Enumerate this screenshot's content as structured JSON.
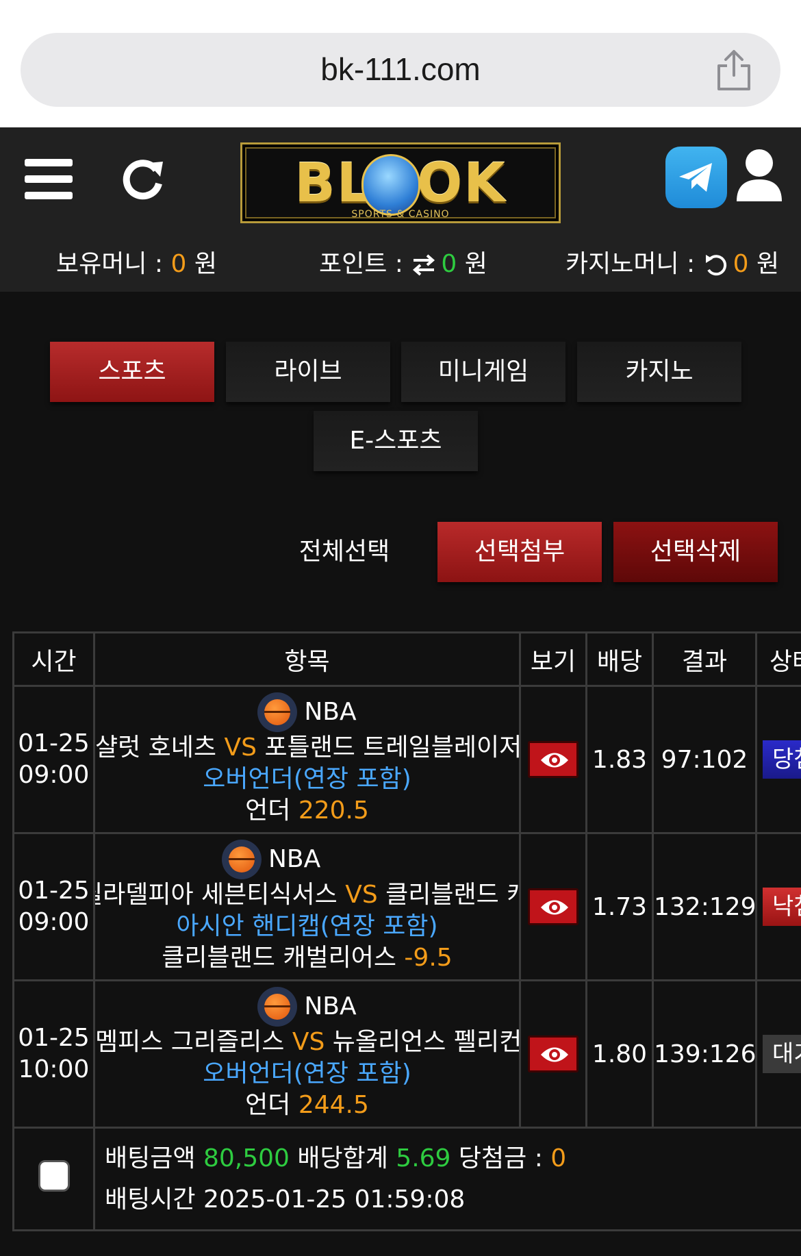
{
  "browser": {
    "url": "bk-111.com"
  },
  "header": {
    "logo_text": "BLOOK",
    "logo_sub": "SPORTS & CASINO",
    "balances": [
      {
        "label": "보유머니 : ",
        "value": "0",
        "unit": " 원"
      },
      {
        "label": "포인트 : ",
        "value": "0",
        "unit": " 원"
      },
      {
        "label": "카지노머니 : ",
        "value": "0",
        "unit": " 원"
      }
    ]
  },
  "tabs": [
    "스포츠",
    "라이브",
    "미니게임",
    "카지노",
    "E-스포츠"
  ],
  "actions": {
    "select_all": "전체선택",
    "attach": "선택첨부",
    "delete": "선택삭제"
  },
  "table": {
    "headers": [
      "시간",
      "항목",
      "보기",
      "배당",
      "결과",
      "상태"
    ],
    "rows": [
      {
        "date": "01-25",
        "time": "09:00",
        "league": "NBA",
        "home": "샬럿 호네츠",
        "vs": "VS",
        "away": "포틀랜드 트레일블레이저스",
        "market": "오버언더(연장 포함)",
        "pick": "언더",
        "line": "220.5",
        "odds": "1.83",
        "result": "97:102",
        "status": "당첨"
      },
      {
        "date": "01-25",
        "time": "09:00",
        "league": "NBA",
        "home": "필라델피아 세븐티식서스",
        "vs": "VS",
        "away": "클리블랜드 캐벌리어스",
        "market": "아시안 핸디캡(연장 포함)",
        "pick": "클리블랜드 캐벌리어스",
        "line": "-9.5",
        "odds": "1.73",
        "result": "132:129",
        "status": "낙첨"
      },
      {
        "date": "01-25",
        "time": "10:00",
        "league": "NBA",
        "home": "멤피스 그리즐리스",
        "vs": "VS",
        "away": "뉴올리언스 펠리컨스",
        "market": "오버언더(연장 포함)",
        "pick": "언더",
        "line": "244.5",
        "odds": "1.80",
        "result": "139:126",
        "status": "대기"
      }
    ],
    "summary": {
      "bet_amount_label": "배팅금액",
      "bet_amount": "80,500",
      "odds_total_label": "배당합계",
      "odds_total": "5.69",
      "win_label": "당첨금 : ",
      "win_amount": "0",
      "bet_time_label": "배팅시간",
      "bet_time": "2025-01-25 01:59:08"
    }
  },
  "colors": {
    "accent_red": "#b72c2c",
    "orange": "#f39c1a",
    "green": "#2ecc40",
    "blue": "#4aa8ff"
  }
}
